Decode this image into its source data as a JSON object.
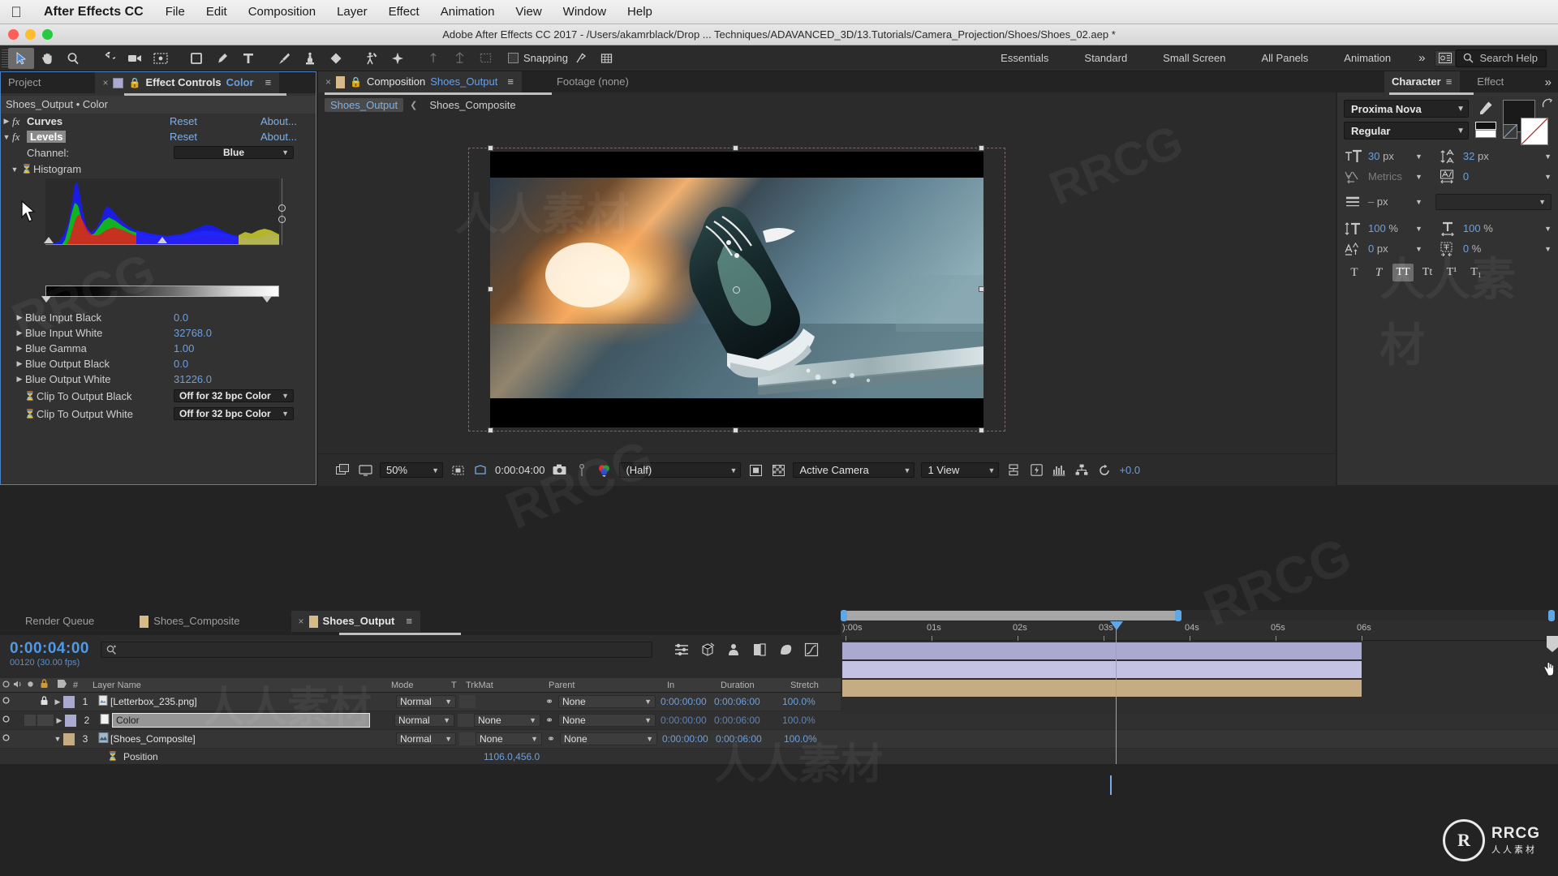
{
  "app": {
    "name": "After Effects CC",
    "menus": [
      "File",
      "Edit",
      "Composition",
      "Layer",
      "Effect",
      "Animation",
      "View",
      "Window",
      "Help"
    ],
    "title": "Adobe After Effects CC 2017 - /Users/akamrblack/Drop ... Techniques/ADAVANCED_3D/13.Tutorials/Camera_Projection/Shoes/Shoes_02.aep *"
  },
  "toolbar": {
    "snapping_label": "Snapping",
    "workspaces": [
      "Essentials",
      "Standard",
      "Small Screen",
      "All Panels",
      "Animation"
    ],
    "overflow": "»",
    "search_placeholder": "Search Help",
    "search_value": "Search Help"
  },
  "effect_controls": {
    "tabs": [
      {
        "label": "Project",
        "active": false
      },
      {
        "label": "Effect Controls",
        "suffix": "Color",
        "active": true
      }
    ],
    "header": "Shoes_Output • Color",
    "effects": [
      {
        "name": "Curves",
        "reset": "Reset",
        "about": "About...",
        "expanded": false
      },
      {
        "name": "Levels",
        "reset": "Reset",
        "about": "About...",
        "expanded": true
      }
    ],
    "channel_label": "Channel:",
    "channel_value": "Blue",
    "histogram_label": "Histogram",
    "params": [
      {
        "label": "Blue Input Black",
        "value": "0.0"
      },
      {
        "label": "Blue Input White",
        "value": "32768.0"
      },
      {
        "label": "Blue Gamma",
        "value": "1.00"
      },
      {
        "label": "Blue Output Black",
        "value": "0.0"
      },
      {
        "label": "Blue Output White",
        "value": "31226.0"
      }
    ],
    "clip_rows": [
      {
        "label": "Clip To Output Black",
        "value": "Off for 32 bpc Color"
      },
      {
        "label": "Clip To Output White",
        "value": "Off for 32 bpc Color"
      }
    ]
  },
  "composition": {
    "tabs": [
      {
        "label": "Composition",
        "suffix": "Shoes_Output",
        "active": true
      },
      {
        "label": "Footage (none)",
        "active": false
      }
    ],
    "breadcrumbs": [
      {
        "label": "Shoes_Output",
        "active": true
      },
      {
        "label": "Shoes_Composite",
        "active": false
      }
    ],
    "bottom": {
      "zoom": "50%",
      "timecode": "0:00:04:00",
      "resolution": "(Half)",
      "view": "Active Camera",
      "views": "1 View",
      "exposure": "+0.0"
    }
  },
  "right_panels": {
    "tabs": [
      {
        "label": "Character",
        "active": true
      },
      {
        "label": "Effect",
        "active": false
      }
    ],
    "overflow": "»",
    "font_family": "Proxima Nova",
    "font_style": "Regular",
    "font_size": "30",
    "font_size_unit": "px",
    "leading": "32",
    "leading_unit": "px",
    "kerning": "Metrics",
    "tracking": "0",
    "stroke_width": "–",
    "stroke_width_unit": "px",
    "stroke_type": "",
    "vertical_scale": "100",
    "vertical_scale_unit": "%",
    "horizontal_scale": "100",
    "horizontal_scale_unit": "%",
    "baseline_shift": "0",
    "baseline_shift_unit": "px",
    "tsume": "0",
    "tsume_unit": "%",
    "style_buttons": [
      "T",
      "T",
      "TT",
      "Tt",
      "T¹",
      "T₁"
    ]
  },
  "timeline": {
    "tabs": [
      {
        "label": "Render Queue",
        "active": false
      },
      {
        "label": "Shoes_Composite",
        "active": false
      },
      {
        "label": "Shoes_Output",
        "active": true
      }
    ],
    "current_time": "0:00:04:00",
    "frame_info": "00120 (30.00 fps)",
    "search_placeholder": "",
    "columns": [
      "#",
      "Layer Name",
      "Mode",
      "T",
      "TrkMat",
      "Parent",
      "In",
      "Duration",
      "Stretch"
    ],
    "layers": [
      {
        "index": "1",
        "name": "[Letterbox_235.png]",
        "mode": "Normal",
        "trkmat": "",
        "parent": "None",
        "in": "0:00:00:00",
        "duration": "0:00:06:00",
        "stretch": "100.0%",
        "locked": true,
        "editing": false,
        "color": "#aaa9cf"
      },
      {
        "index": "2",
        "name": "Color",
        "mode": "Normal",
        "trkmat": "None",
        "parent": "None",
        "in": "0:00:00:00",
        "duration": "0:00:06:00",
        "stretch": "100.0%",
        "locked": false,
        "editing": true,
        "color": "#c3c2e4"
      },
      {
        "index": "3",
        "name": "[Shoes_Composite]",
        "mode": "Normal",
        "trkmat": "None",
        "parent": "None",
        "in": "0:00:00:00",
        "duration": "0:00:06:00",
        "stretch": "100.0%",
        "locked": false,
        "editing": false,
        "color": "#c6ac82"
      }
    ],
    "property": {
      "name": "Position",
      "value": "1106.0,456.0"
    },
    "ruler_ticks": [
      "):00s",
      "01s",
      "02s",
      "03s",
      "04s",
      "05s",
      "06s"
    ]
  },
  "watermarks": {
    "rrcg": "RRCG",
    "cn": "人人素材",
    "logo_initial": "R",
    "logo_name": "RRCG",
    "logo_sub": "人人素材"
  },
  "colors": {
    "accent_blue": "#6f9fdc",
    "panel_bg": "#323232",
    "window_bg": "#232323",
    "selection": "#4c7fc4"
  }
}
